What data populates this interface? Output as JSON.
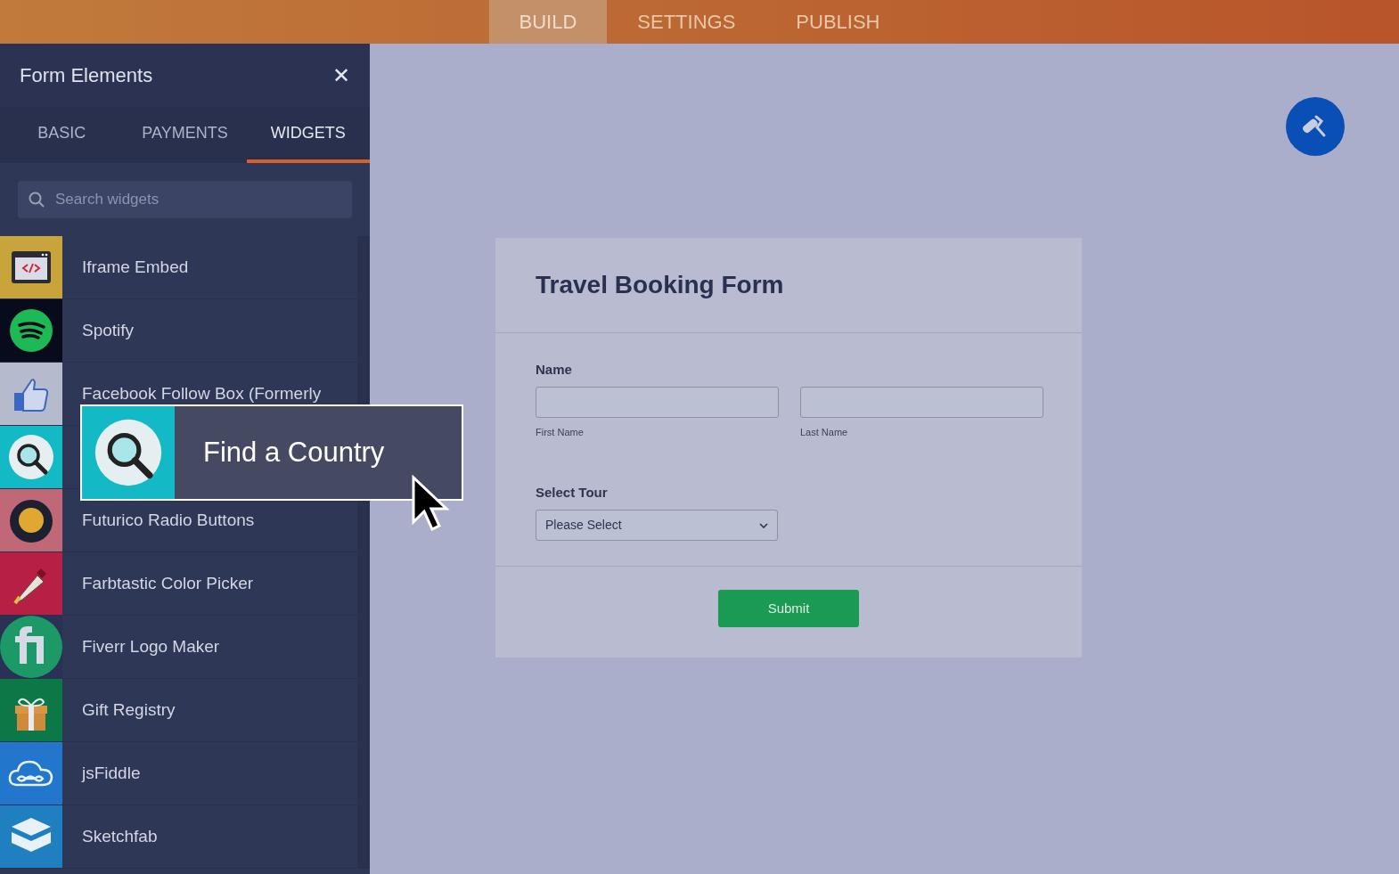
{
  "top_tabs": [
    {
      "label": "BUILD",
      "selected": true
    },
    {
      "label": "SETTINGS",
      "selected": false
    },
    {
      "label": "PUBLISH",
      "selected": false
    }
  ],
  "panel": {
    "title": "Form Elements",
    "close": "✕",
    "tabs": [
      {
        "label": "BASIC",
        "selected": false
      },
      {
        "label": "PAYMENTS",
        "selected": false
      },
      {
        "label": "WIDGETS",
        "selected": true
      }
    ],
    "search": {
      "placeholder": "Search widgets"
    },
    "widgets": [
      {
        "kind": "iframe",
        "label": "Iframe Embed"
      },
      {
        "kind": "spotify",
        "label": "Spotify"
      },
      {
        "kind": "thumb",
        "label": "Facebook Follow Box (Formerly"
      },
      {
        "kind": "globe"
      },
      {
        "kind": "radio",
        "label": "Futurico Radio Buttons"
      },
      {
        "kind": "dropper",
        "label": "Farbtastic Color Picker"
      },
      {
        "kind": "fi",
        "label": "Fiverr Logo Maker"
      },
      {
        "kind": "gift",
        "label": "Gift Registry"
      },
      {
        "kind": "cloud",
        "label": "jsFiddle"
      },
      {
        "kind": "cube",
        "label": "Sketchfab"
      }
    ]
  },
  "drag_preview": {
    "kind": "globe",
    "label": "Find a Country"
  },
  "form": {
    "title": "Travel Booking Form",
    "name_label": "Name",
    "first_sublabel": "First Name",
    "last_sublabel": "Last Name",
    "tour_label": "Select Tour",
    "tour_value": "Please Select",
    "submit": "Submit"
  }
}
